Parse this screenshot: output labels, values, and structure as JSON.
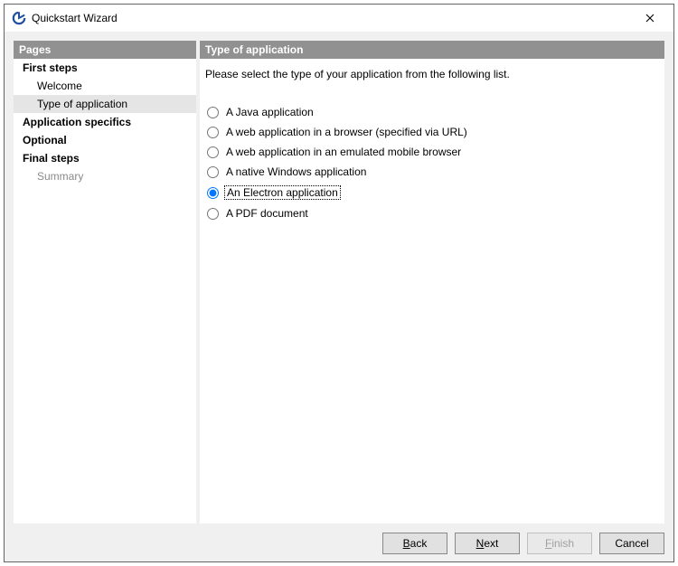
{
  "window": {
    "title": "Quickstart Wizard"
  },
  "sidebar": {
    "heading": "Pages",
    "items": [
      {
        "label": "First steps",
        "kind": "section"
      },
      {
        "label": "Welcome",
        "kind": "sub"
      },
      {
        "label": "Type of application",
        "kind": "sub",
        "selected": true
      },
      {
        "label": "Application specifics",
        "kind": "section"
      },
      {
        "label": "Optional",
        "kind": "section"
      },
      {
        "label": "Final steps",
        "kind": "section"
      },
      {
        "label": "Summary",
        "kind": "sub",
        "dim": true
      }
    ]
  },
  "main": {
    "heading": "Type of application",
    "intro": "Please select the type of your application from the following list.",
    "options": [
      {
        "label": "A Java application"
      },
      {
        "label": "A web application in a browser (specified via URL)"
      },
      {
        "label": "A web application in an emulated mobile browser"
      },
      {
        "label": "A native Windows application"
      },
      {
        "label": "An Electron application",
        "selected": true,
        "focus": true
      },
      {
        "label": "A PDF document"
      }
    ]
  },
  "buttons": {
    "back": {
      "accel": "B",
      "rest": "ack"
    },
    "next": {
      "accel": "N",
      "rest": "ext"
    },
    "finish": {
      "accel": "F",
      "rest": "inish",
      "disabled": true
    },
    "cancel": {
      "label": "Cancel"
    }
  }
}
